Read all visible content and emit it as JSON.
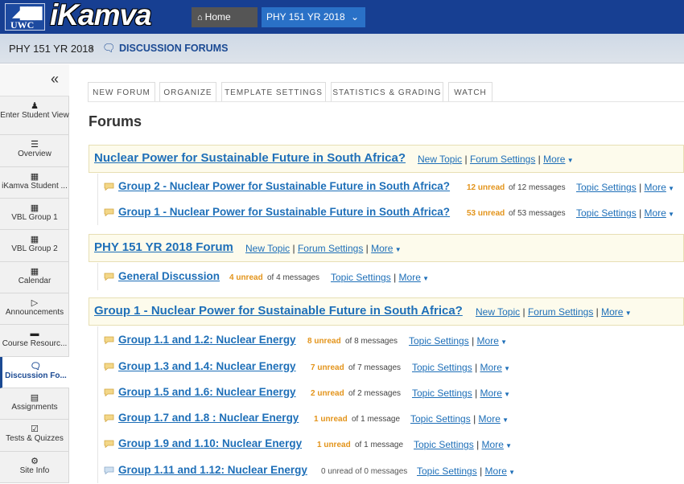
{
  "header": {
    "logo_text": "UWC",
    "brand": "iKamva",
    "home_label": "Home",
    "site_label": "PHY 151 YR 2018"
  },
  "breadcrumb": {
    "site": "PHY 151 YR 2018",
    "tool": "DISCUSSION FORUMS"
  },
  "sidebar": {
    "items": [
      {
        "label": "Enter Student View",
        "icon": "user-icon"
      },
      {
        "label": "Overview",
        "icon": "list-icon"
      },
      {
        "label": "iKamva Student ...",
        "icon": "book-icon"
      },
      {
        "label": "VBL Group 1",
        "icon": "book-icon"
      },
      {
        "label": "VBL Group 2",
        "icon": "book-icon"
      },
      {
        "label": "Calendar",
        "icon": "calendar-icon"
      },
      {
        "label": "Announcements",
        "icon": "megaphone-icon"
      },
      {
        "label": "Course Resourc...",
        "icon": "folder-icon"
      },
      {
        "label": "Discussion Fo...",
        "icon": "chat-icon"
      },
      {
        "label": "Assignments",
        "icon": "file-icon"
      },
      {
        "label": "Tests & Quizzes",
        "icon": "checkbox-icon"
      },
      {
        "label": "Site Info",
        "icon": "gear-icon"
      }
    ]
  },
  "tabs": [
    "NEW FORUM",
    "ORGANIZE",
    "TEMPLATE SETTINGS",
    "STATISTICS & GRADING",
    "WATCH"
  ],
  "page_title": "Forums",
  "forums": [
    {
      "title": "Nuclear Power for Sustainable Future in South Africa?",
      "links": {
        "new_topic": "New Topic",
        "settings": "Forum Settings",
        "more": "More"
      },
      "topics": [
        {
          "title": "Group 2 - Nuclear Power for Sustainable Future in South Africa?",
          "unread": "12 unread",
          "of": "of 12 messages",
          "settings": "Topic Settings",
          "more": "More"
        },
        {
          "title": "Group 1 - Nuclear Power for Sustainable Future in South Africa?",
          "unread": "53 unread",
          "of": "of 53 messages",
          "settings": "Topic Settings",
          "more": "More"
        }
      ]
    },
    {
      "title": "PHY 151 YR 2018 Forum",
      "links": {
        "new_topic": "New Topic",
        "settings": "Forum Settings",
        "more": "More"
      },
      "topics": [
        {
          "title": "General Discussion",
          "unread": "4 unread",
          "of": "of 4 messages",
          "settings": "Topic Settings",
          "more": "More"
        }
      ]
    },
    {
      "title": "Group 1 - Nuclear Power for Sustainable Future in South Africa?",
      "links": {
        "new_topic": "New Topic",
        "settings": "Forum Settings",
        "more": "More"
      },
      "topics": [
        {
          "title": "Group 1.1 and 1.2: Nuclear Energy",
          "unread": "8 unread",
          "of": "of 8 messages",
          "settings": "Topic Settings",
          "more": "More"
        },
        {
          "title": " Group 1.3 and 1.4: Nuclear Energy",
          "unread": "7 unread",
          "of": "of 7 messages",
          "settings": "Topic Settings",
          "more": "More"
        },
        {
          "title": " Group 1.5 and 1.6: Nuclear Energy",
          "unread": "2 unread",
          "of": "of 2 messages",
          "settings": "Topic Settings",
          "more": "More"
        },
        {
          "title": " Group 1.7 and 1.8 : Nuclear Energy",
          "unread": "1 unread",
          "of": "of 1 message",
          "settings": "Topic Settings",
          "more": "More"
        },
        {
          "title": " Group 1.9 and 1.10: Nuclear Energy",
          "unread": "1 unread",
          "of": "of 1 message",
          "settings": "Topic Settings",
          "more": "More"
        },
        {
          "title": " Group 1.11 and 1.12: Nuclear Energy",
          "unread": "0 unread of 0 messages",
          "of": "",
          "settings": "Topic Settings",
          "more": "More"
        }
      ]
    }
  ],
  "colors": {
    "header": "#173f92",
    "link": "#1e6fb8",
    "unread": "#e3941b",
    "forum_bg": "#fdfbec"
  }
}
